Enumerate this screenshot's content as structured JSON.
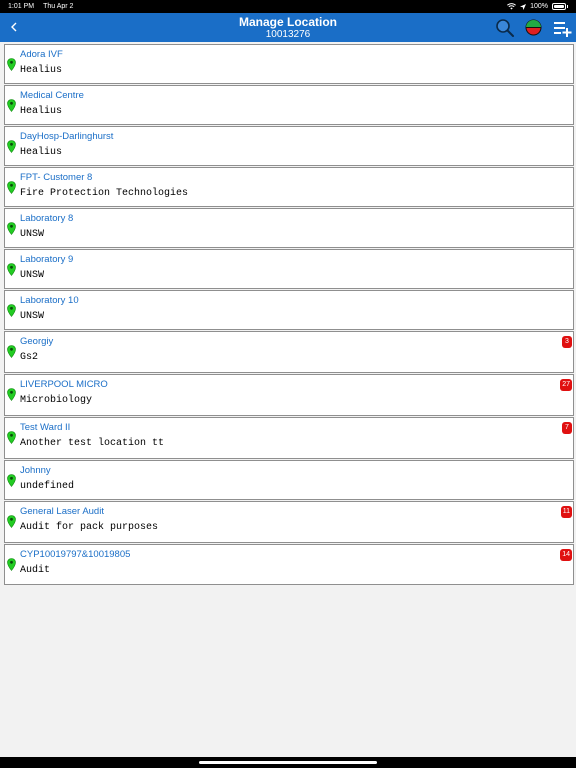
{
  "status_bar": {
    "time": "1:01 PM",
    "date": "Thu Apr 2",
    "wifi_icon": "wifi-icon",
    "location_icon": "location-arrow-icon",
    "battery": "100%"
  },
  "nav": {
    "back_icon": "back-chevron-icon",
    "title": "Manage Location",
    "subtitle": "10013276",
    "search_icon": "search-icon",
    "status_icon": "status-circle-icon",
    "add_icon": "add-list-icon",
    "color": "#1a6ec7"
  },
  "locations": [
    {
      "name": "Adora IVF",
      "org": "Healius",
      "badge": ""
    },
    {
      "name": "Medical Centre",
      "org": "Healius",
      "badge": ""
    },
    {
      "name": "DayHosp-Darlinghurst",
      "org": "Healius",
      "badge": ""
    },
    {
      "name": "FPT- Customer 8",
      "org": "Fire Protection Technologies",
      "badge": ""
    },
    {
      "name": "Laboratory 8",
      "org": "UNSW",
      "badge": ""
    },
    {
      "name": "Laboratory 9",
      "org": "UNSW",
      "badge": ""
    },
    {
      "name": "Laboratory 10",
      "org": "UNSW",
      "badge": ""
    },
    {
      "name": "Georgiy",
      "org": "Gs2",
      "badge": "3"
    },
    {
      "name": "LIVERPOOL MICRO",
      "org": "Microbiology",
      "badge": "27"
    },
    {
      "name": "Test Ward II",
      "org": "Another test location tt",
      "badge": "7"
    },
    {
      "name": "Johnny",
      "org": "undefined",
      "badge": ""
    },
    {
      "name": "General Laser Audit",
      "org": "Audit for pack purposes",
      "badge": "11"
    },
    {
      "name": "CYP10019797&10019805",
      "org": "Audit",
      "badge": "14"
    }
  ],
  "colors": {
    "pin": "#22cc22",
    "badge": "#e01010",
    "title_text": "#1a6ec7"
  }
}
